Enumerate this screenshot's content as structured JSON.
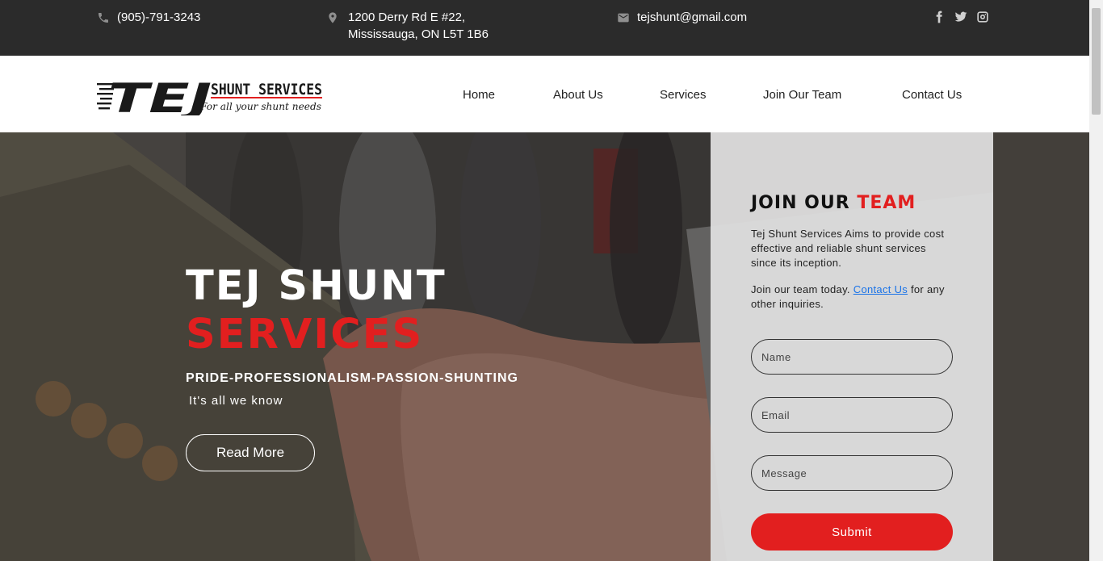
{
  "topbar": {
    "phone": "(905)-791-3243",
    "address_line1": "1200 Derry Rd E #22,",
    "address_line2": "Mississauga, ON L5T 1B6",
    "email": "tejshunt@gmail.com",
    "icons": [
      "phone-icon",
      "location-pin-icon",
      "mail-icon"
    ],
    "social": [
      "facebook-icon",
      "twitter-icon",
      "instagram-icon"
    ]
  },
  "header": {
    "logo": {
      "mark": "TEJ",
      "name": "SHUNT SERVICES",
      "tagline": "For all your shunt needs"
    },
    "nav": [
      "Home",
      "About Us",
      "Services",
      "Join Our Team",
      "Contact Us"
    ]
  },
  "hero": {
    "title_line1": "TEJ SHUNT",
    "title_line2": "SERVICES",
    "tagline": "PRIDE-PROFESSIONALISM-PASSION-SHUNTING",
    "subtitle": "It's all we know",
    "cta": "Read More"
  },
  "form": {
    "title_a": "JOIN OUR",
    "title_b": "TEAM",
    "description": "Tej Shunt Services Aims to provide cost effective and reliable shunt services since its inception.",
    "join_text_a": "Join our team today.",
    "join_link": "Contact Us",
    "join_text_b": "for any other inquiries.",
    "name_placeholder": "Name",
    "email_placeholder": "Email",
    "message_placeholder": "Message",
    "submit": "Submit"
  },
  "colors": {
    "accent": "#e21f1f",
    "topbar_bg": "#2b2b2b",
    "link": "#1a73e8"
  }
}
